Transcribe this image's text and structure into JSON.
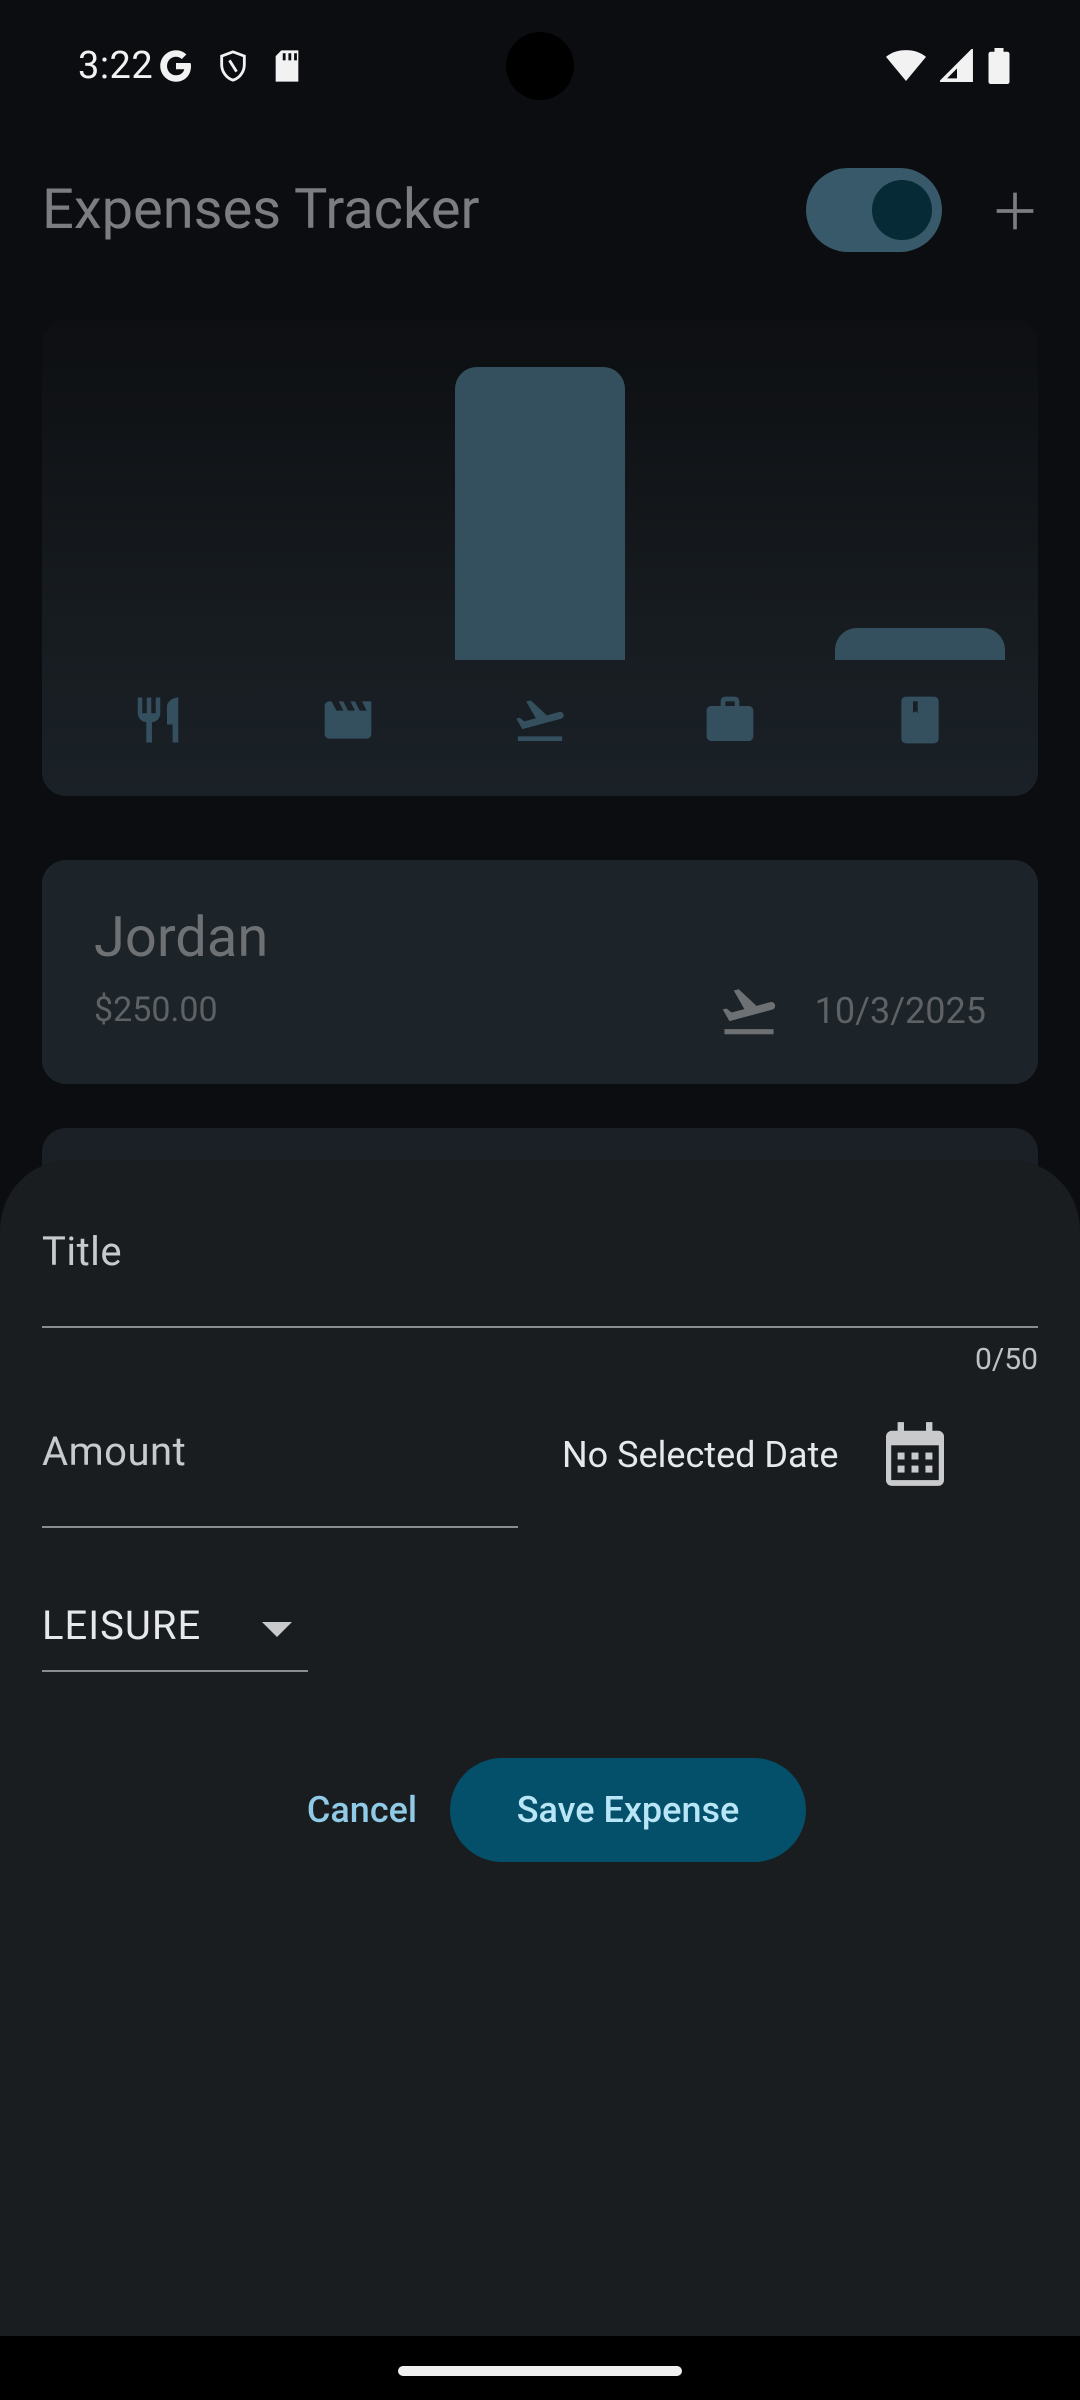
{
  "status_bar": {
    "time": "3:22",
    "left_icons": [
      "google-icon",
      "shield-icon",
      "sd-card-icon"
    ],
    "right_icons": [
      "wifi-icon",
      "signal-icon",
      "battery-icon"
    ]
  },
  "app_bar": {
    "title": "Expenses Tracker",
    "theme_toggle": "on",
    "add_icon": "plus-icon"
  },
  "chart_data": {
    "type": "bar",
    "categories": [
      "FOOD",
      "LEISURE",
      "TRAVEL",
      "WORK",
      "BOOKS"
    ],
    "category_icons": [
      "restaurant-icon",
      "movie-icon",
      "flight-icon",
      "work-icon",
      "book-icon"
    ],
    "values": [
      0,
      0,
      1,
      0,
      0.11
    ],
    "ylim": [
      0,
      1
    ]
  },
  "expenses": [
    {
      "title": "Jordan",
      "amount": "$250.00",
      "category_icon": "flight-icon",
      "date": "10/3/2025"
    }
  ],
  "sheet": {
    "title_label": "Title",
    "title_counter": "0/50",
    "amount_label": "Amount",
    "date_text": "No Selected Date",
    "category_value": "LEISURE",
    "cancel_label": "Cancel",
    "save_label": "Save Expense"
  },
  "colors": {
    "background": "#0b0d10",
    "sheet": "#191d20",
    "bar": "#34505f",
    "save_button": "#04506a",
    "accent_text": "#8fcae6"
  }
}
